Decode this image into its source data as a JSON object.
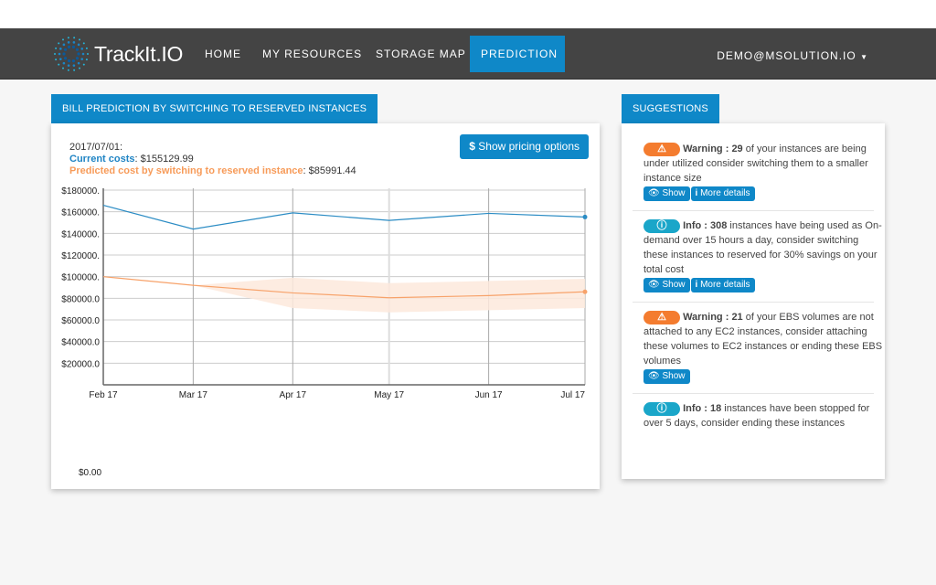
{
  "nav": {
    "logo": "TrackIt.IO",
    "items": [
      {
        "label": "HOME"
      },
      {
        "label": "MY RESOURCES"
      },
      {
        "label": "STORAGE MAP"
      },
      {
        "label": "PREDICTION",
        "active": true
      }
    ],
    "user": "DEMO@MSOLUTION.IO"
  },
  "prediction": {
    "title": "BILL PREDICTION BY SWITCHING TO RESERVED INSTANCES",
    "date": "2017/07/01:",
    "current_label": "Current costs",
    "current_value": ": $155129.99",
    "predicted_label": "Predicted cost by switching to reserved instance",
    "predicted_value": ": $85991.44",
    "pricing_button": "Show pricing options",
    "zero_label": "$0.00"
  },
  "chart_data": {
    "type": "line",
    "categories": [
      "Feb 17",
      "Mar 17",
      "Apr 17",
      "May 17",
      "Jun 17",
      "Jul 17"
    ],
    "y_ticks": [
      "$180000.",
      "$160000.",
      "$140000.",
      "$120000.",
      "$100000.",
      "$80000.0",
      "$60000.0",
      "$40000.0",
      "$20000.0"
    ],
    "ylim": [
      0,
      180000
    ],
    "grid": true,
    "colors": {
      "current": "#2b8cc4",
      "predicted": "#f7a26a",
      "band": "#fde9dc"
    },
    "series": [
      {
        "values": [
          166000,
          144000,
          159000,
          152000,
          158500,
          155129.99
        ]
      },
      {
        "values": [
          100000,
          92000,
          85000,
          80500,
          82500,
          85991.44
        ],
        "band_upper": [
          100000,
          92000,
          99000,
          94000,
          96000,
          98000
        ],
        "band_lower": [
          100000,
          92000,
          71000,
          67000,
          69000,
          71000
        ]
      }
    ]
  },
  "suggestions": {
    "title": "SUGGESTIONS",
    "items": [
      {
        "type": "warning",
        "label": "Warning : ",
        "count": "29",
        "text": " of your instances are being under utilized consider switching them to a smaller instance size",
        "buttons": [
          "Show",
          "More details"
        ]
      },
      {
        "type": "info",
        "label": "Info : ",
        "count": "308",
        "text": " instances have being used as On-demand over 15 hours a day, consider switching these instances to reserved for 30% savings on your total cost",
        "buttons": [
          "Show",
          "More details"
        ]
      },
      {
        "type": "warning",
        "label": "Warning : ",
        "count": "21",
        "text": " of your EBS volumes are not attached to any EC2 instances, consider attaching these volumes to EC2 instances or ending these EBS volumes",
        "buttons": [
          "Show"
        ]
      },
      {
        "type": "info",
        "label": "Info : ",
        "count": "18",
        "text": " instances have been stopped for over 5 days, consider ending these instances",
        "buttons": []
      }
    ]
  }
}
